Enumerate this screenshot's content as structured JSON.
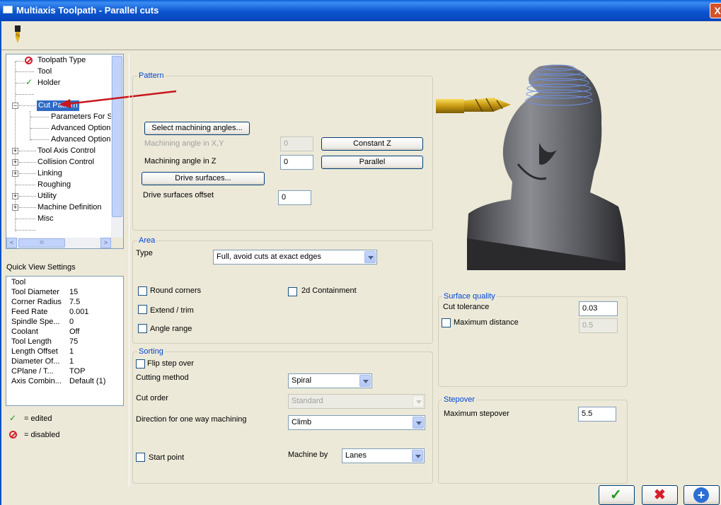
{
  "window": {
    "title": "Multiaxis Toolpath - Parallel cuts",
    "close_label": "X"
  },
  "colors": {
    "accent": "#0046d5",
    "titlebar": "#0a5fd8",
    "arrow": "#c8161d",
    "check": "#1b9a1b",
    "disabled_icon": "#d4202a"
  },
  "tree": {
    "items": [
      {
        "label": "Toolpath Type",
        "icon": "disabled-icon"
      },
      {
        "label": "Tool",
        "icon": ""
      },
      {
        "label": "Holder",
        "icon": "check-icon"
      },
      {
        "label": "",
        "icon": ""
      },
      {
        "label": "Cut Pattern",
        "icon": "",
        "selected": true
      },
      {
        "label": "Parameters For Su",
        "icon": ""
      },
      {
        "label": "Advanced Option",
        "icon": ""
      },
      {
        "label": "Advanced Option",
        "icon": ""
      },
      {
        "label": "Tool Axis Control",
        "icon": ""
      },
      {
        "label": "Collision Control",
        "icon": ""
      },
      {
        "label": "Linking",
        "icon": ""
      },
      {
        "label": "Roughing",
        "icon": ""
      },
      {
        "label": "Utility",
        "icon": ""
      },
      {
        "label": "Machine Definition",
        "icon": ""
      },
      {
        "label": "Misc",
        "icon": ""
      }
    ],
    "scroll_left": "<",
    "scroll_right": ">",
    "scroll_grip": "III"
  },
  "quick_view": {
    "title": "Quick View Settings",
    "rows": [
      {
        "key": "Tool",
        "value": ""
      },
      {
        "key": "Tool Diameter",
        "value": "15"
      },
      {
        "key": "Corner Radius",
        "value": "7.5"
      },
      {
        "key": "Feed Rate",
        "value": "0.001"
      },
      {
        "key": "Spindle Spe...",
        "value": "0"
      },
      {
        "key": "Coolant",
        "value": "Off"
      },
      {
        "key": "Tool Length",
        "value": "75"
      },
      {
        "key": "Length Offset",
        "value": "1"
      },
      {
        "key": "Diameter Of...",
        "value": "1"
      },
      {
        "key": "CPlane / T...",
        "value": "TOP"
      },
      {
        "key": "Axis Combin...",
        "value": "Default (1)"
      }
    ]
  },
  "legend": {
    "edited": "= edited",
    "disabled": "= disabled"
  },
  "pattern": {
    "title": "Pattern",
    "select_angles_btn": "Select machining angles...",
    "angle_xy_label": "Machining angle in X,Y",
    "angle_xy_value": "0",
    "constant_z_btn": "Constant Z",
    "angle_z_label": "Machining angle in Z",
    "angle_z_value": "0",
    "parallel_btn": "Parallel",
    "drive_surfaces_btn": "Drive surfaces...",
    "drive_offset_label": "Drive surfaces offset",
    "drive_offset_value": "0"
  },
  "area": {
    "title": "Area",
    "type_label": "Type",
    "type_value": "Full, avoid cuts at exact edges",
    "round_corners": "Round corners",
    "containment_2d": "2d Containment",
    "extend_trim": "Extend / trim",
    "angle_range": "Angle range"
  },
  "sorting": {
    "title": "Sorting",
    "flip_step": "Flip step over",
    "cutting_method_label": "Cutting method",
    "cutting_method_value": "Spiral",
    "cut_order_label": "Cut order",
    "cut_order_value": "Standard",
    "direction_label": "Direction for one way machining",
    "direction_value": "Climb",
    "start_point": "Start point",
    "machine_by_label": "Machine by",
    "machine_by_value": "Lanes"
  },
  "surface_quality": {
    "title": "Surface quality",
    "cut_tol_label": "Cut tolerance",
    "cut_tol_value": "0.03",
    "max_distance_label": "Maximum distance",
    "max_distance_value": "0.5"
  },
  "stepover": {
    "title": "Stepover",
    "max_stepover_label": "Maximum stepover",
    "max_stepover_value": "5.5"
  }
}
